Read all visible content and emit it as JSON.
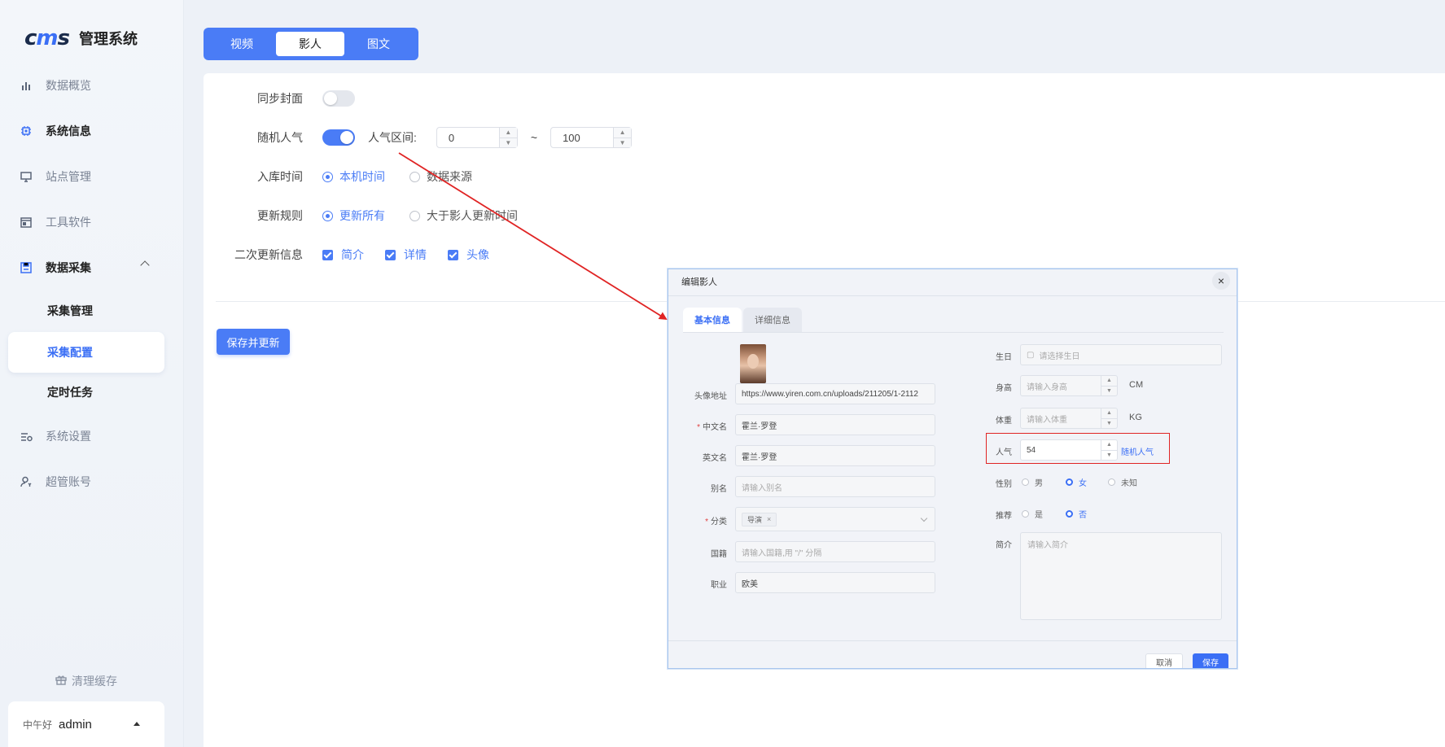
{
  "app": {
    "logo_mark": "cms",
    "title": "管理系统"
  },
  "sidebar": {
    "items": [
      {
        "label": "数据概览",
        "icon": "bar-chart-icon"
      },
      {
        "label": "系统信息",
        "icon": "chip-icon"
      },
      {
        "label": "站点管理",
        "icon": "monitor-icon"
      },
      {
        "label": "工具软件",
        "icon": "window-icon"
      },
      {
        "label": "数据采集",
        "icon": "save-icon"
      },
      {
        "label": "采集管理"
      },
      {
        "label": "采集配置"
      },
      {
        "label": "定时任务"
      },
      {
        "label": "系统设置",
        "icon": "settings-icon"
      },
      {
        "label": "超管账号",
        "icon": "user-icon"
      }
    ],
    "clear_cache": "清理缓存",
    "greeting": "中午好",
    "username": "admin"
  },
  "tabs": {
    "video": "视频",
    "actor": "影人",
    "article": "图文",
    "active": "影人"
  },
  "form": {
    "sync_cover_label": "同步封面",
    "random_pop_label": "随机人气",
    "pop_range_label": "人气区间:",
    "pop_min": "0",
    "pop_max": "100",
    "range_sep": "~",
    "import_time_label": "入库时间",
    "import_opt_local": "本机时间",
    "import_opt_source": "数据来源",
    "update_rule_label": "更新规则",
    "update_opt_all": "更新所有",
    "update_opt_newer": "大于影人更新时间",
    "second_update_label": "二次更新信息",
    "chk_intro": "简介",
    "chk_detail": "详情",
    "chk_avatar": "头像",
    "save_button": "保存并更新"
  },
  "dialog": {
    "title": "编辑影人",
    "tab_basic": "基本信息",
    "tab_detail": "详细信息",
    "avatar_url_label": "头像地址",
    "avatar_url": "https://www.yiren.com.cn/uploads/211205/1-2112",
    "cn_name_label": "中文名",
    "cn_name": "霍兰·罗登",
    "en_name_label": "英文名",
    "en_name": "霍兰·罗登",
    "alias_label": "别名",
    "alias_placeholder": "请输入别名",
    "category_label": "分类",
    "category_tag": "导演",
    "nationality_label": "国籍",
    "nationality_placeholder": "请输入国籍,用 \"/\" 分隔",
    "job_label": "职业",
    "job": "欧美",
    "birthday_label": "生日",
    "birthday_placeholder": "请选择生日",
    "height_label": "身高",
    "height_placeholder": "请输入身高",
    "height_unit": "CM",
    "weight_label": "体重",
    "weight_placeholder": "请输入体重",
    "weight_unit": "KG",
    "pop_label": "人气",
    "pop_value": "54",
    "random_pop_link": "随机人气",
    "gender_label": "性别",
    "gender_male": "男",
    "gender_female": "女",
    "gender_unknown": "未知",
    "recommend_label": "推荐",
    "recommend_yes": "是",
    "recommend_no": "否",
    "intro_label": "简介",
    "intro_placeholder": "请输入简介",
    "cancel_button": "取消",
    "save_button": "保存"
  },
  "colors": {
    "accent": "#4a7cf6",
    "annotation_red": "#e02424"
  }
}
